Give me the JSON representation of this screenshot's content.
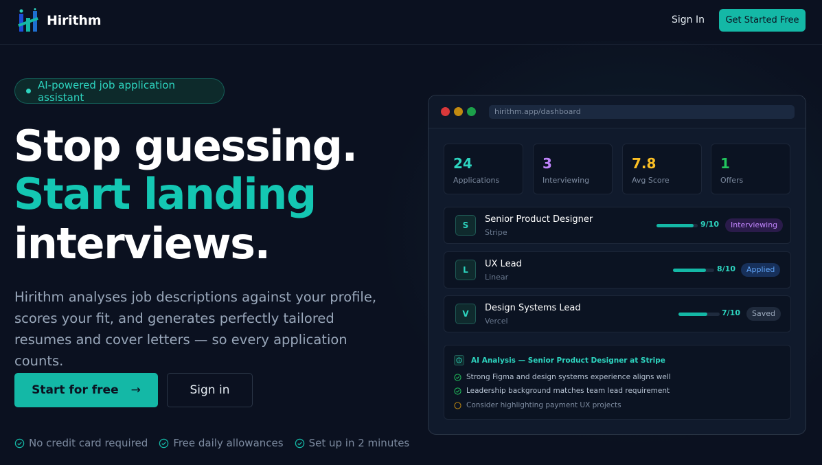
{
  "nav": {
    "brand": "Hirithm",
    "sign_in": "Sign In",
    "cta": "Get Started Free"
  },
  "hero": {
    "pill": "AI-powered job application assistant",
    "headline_1": "Stop guessing.",
    "headline_2": "Start landing",
    "headline_3": "interviews.",
    "lead": "Hirithm analyses job descriptions against your profile, scores your fit, and generates perfectly tailored resumes and cover letters — so every application counts.",
    "primary_button": "Start for free",
    "primary_arrow": "→",
    "secondary_button": "Sign in",
    "perks": [
      "No credit card required",
      "Free daily allowances",
      "Set up in 2 minutes"
    ]
  },
  "dashboard": {
    "url": "hirithm.app/dashboard",
    "stats": [
      {
        "value": "24",
        "label": "Applications",
        "color": "#2dd4bf"
      },
      {
        "value": "3",
        "label": "Interviewing",
        "color": "#c084fc"
      },
      {
        "value": "7.8",
        "label": "Avg Score",
        "color": "#fbbf24"
      },
      {
        "value": "1",
        "label": "Offers",
        "color": "#22c55e"
      }
    ],
    "jobs": [
      {
        "initial": "S",
        "title": "Senior Product Designer",
        "company": "Stripe",
        "score": "9/10",
        "fit": 0.9,
        "status": "Interviewing",
        "status_color": "#c084fc",
        "status_bg": "#2a1b4a"
      },
      {
        "initial": "L",
        "title": "UX Lead",
        "company": "Linear",
        "score": "8/10",
        "fit": 0.8,
        "status": "Applied",
        "status_color": "#60a5fa",
        "status_bg": "#17305a"
      },
      {
        "initial": "V",
        "title": "Design Systems Lead",
        "company": "Vercel",
        "score": "7/10",
        "fit": 0.7,
        "status": "Saved",
        "status_color": "#9aa8bb",
        "status_bg": "#1f2a3c"
      }
    ],
    "analysis": {
      "title": "AI Analysis — Senior Product Designer at Stripe",
      "points": [
        {
          "text": "Strong Figma and design systems experience aligns well",
          "kind": "check"
        },
        {
          "text": "Leadership background matches team lead requirement",
          "kind": "check"
        },
        {
          "text": "Consider highlighting payment UX projects",
          "kind": "hint"
        }
      ]
    }
  },
  "colors": {
    "accent": "#14b8a6",
    "background": "#0b1120"
  }
}
